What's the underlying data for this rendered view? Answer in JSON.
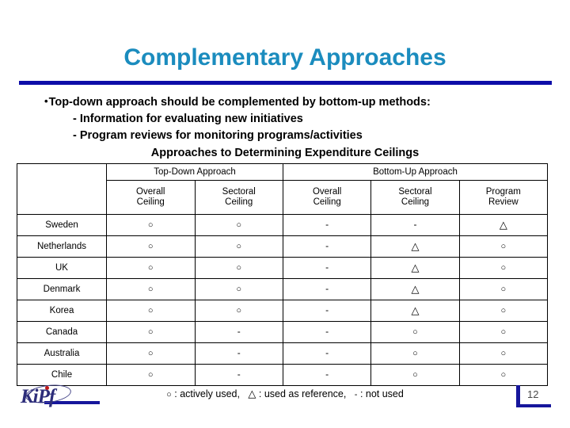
{
  "slide": {
    "title": "Complementary Approaches",
    "title_color": "#1b8cbe",
    "rule_color": "#0d0da8",
    "background": "#ffffff"
  },
  "bullets": {
    "dot": "•",
    "line1": "Top-down approach should be complemented by bottom-up methods:",
    "line2": "- Information for evaluating new initiatives",
    "line3": "- Program reviews for monitoring programs/activities",
    "subtitle": "Approaches to Determining Expenditure Ceilings"
  },
  "table": {
    "corner_label": "",
    "group_headers": [
      {
        "label": "Top-Down Approach",
        "span": 2
      },
      {
        "label": "Bottom-Up Approach",
        "span": 3
      }
    ],
    "sub_headers": [
      "Overall\nCeiling",
      "Sectoral\nCeiling",
      "Overall\nCeiling",
      "Sectoral\nCeiling",
      "Program\nReview"
    ],
    "sub_headers_lines": [
      [
        "Overall",
        "Ceiling"
      ],
      [
        "Sectoral",
        "Ceiling"
      ],
      [
        "Overall",
        "Ceiling"
      ],
      [
        "Sectoral",
        "Ceiling"
      ],
      [
        "Program",
        "Review"
      ]
    ],
    "rows": [
      {
        "country": "Sweden",
        "marks": [
          "o",
          "o",
          "-",
          "-",
          "tri"
        ]
      },
      {
        "country": "Netherlands",
        "marks": [
          "o",
          "o",
          "-",
          "tri",
          "o"
        ]
      },
      {
        "country": "UK",
        "marks": [
          "o",
          "o",
          "-",
          "tri",
          "o"
        ]
      },
      {
        "country": "Denmark",
        "marks": [
          "o",
          "o",
          "-",
          "tri",
          "o"
        ]
      },
      {
        "country": "Korea",
        "marks": [
          "o",
          "o",
          "-",
          "tri",
          "o"
        ]
      },
      {
        "country": "Canada",
        "marks": [
          "o",
          "-",
          "-",
          "o",
          "o"
        ]
      },
      {
        "country": "Australia",
        "marks": [
          "o",
          "-",
          "-",
          "o",
          "o"
        ]
      },
      {
        "country": "Chile",
        "marks": [
          "o",
          "-",
          "-",
          "o",
          "o"
        ]
      }
    ],
    "symbols": {
      "o": "○",
      "tri": "△",
      "-": "-"
    }
  },
  "legend": {
    "circle_symbol": "○",
    "circle_text": ": actively used,",
    "triangle_symbol": "△",
    "triangle_text": ": used as reference,",
    "dash_symbol": "-",
    "dash_text": ": not used"
  },
  "footer": {
    "logo_text": "KiPf",
    "logo_color": "#2d2d7a",
    "logo_dot_color": "#c01818",
    "page_number": "12",
    "accent_color": "#16169c"
  }
}
